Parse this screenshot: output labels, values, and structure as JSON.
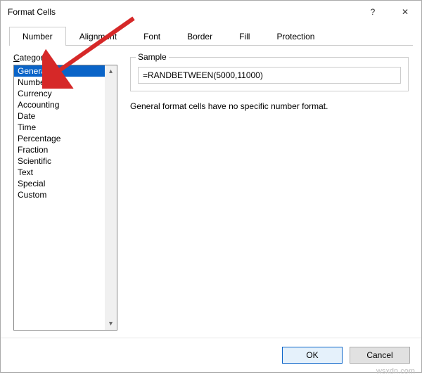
{
  "titlebar": {
    "title": "Format Cells",
    "help_icon": "?",
    "close_icon": "✕"
  },
  "tabs": [
    {
      "label": "Number",
      "active": true
    },
    {
      "label": "Alignment",
      "active": false
    },
    {
      "label": "Font",
      "active": false
    },
    {
      "label": "Border",
      "active": false
    },
    {
      "label": "Fill",
      "active": false
    },
    {
      "label": "Protection",
      "active": false
    }
  ],
  "category": {
    "label_u": "C",
    "label_rest": "ategory:",
    "items": [
      "General",
      "Number",
      "Currency",
      "Accounting",
      "Date",
      "Time",
      "Percentage",
      "Fraction",
      "Scientific",
      "Text",
      "Special",
      "Custom"
    ],
    "selected": 0
  },
  "sample": {
    "label": "Sample",
    "value": "=RANDBETWEEN(5000,11000)"
  },
  "description": "General format cells have no specific number format.",
  "buttons": {
    "ok": "OK",
    "cancel": "Cancel"
  },
  "watermark": "wsxdn.com"
}
